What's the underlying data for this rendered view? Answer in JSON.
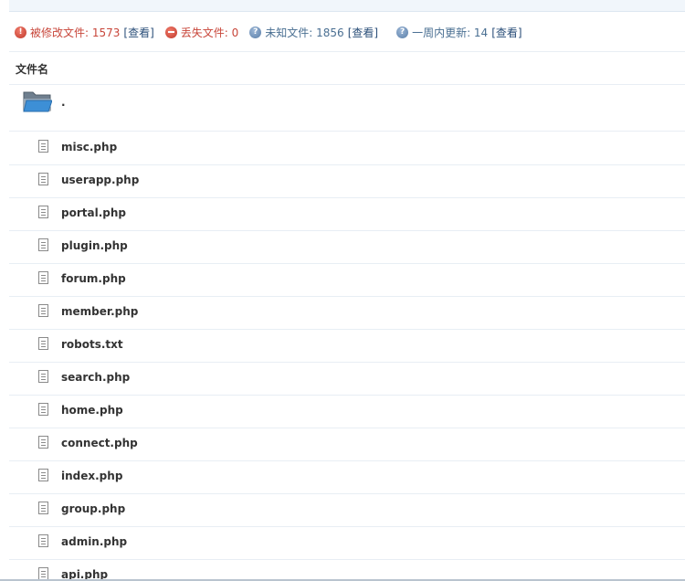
{
  "stats": {
    "modified": {
      "label": "被修改文件: 1573",
      "link": "[查看]",
      "icon": "warning-icon",
      "color": "#c8463a"
    },
    "missing": {
      "label": "丢失文件: 0",
      "icon": "minus-circle-icon",
      "color": "#c8463a"
    },
    "unknown": {
      "label": "未知文件: 1856",
      "link": "[查看]",
      "icon": "help-icon",
      "color": "#4a6f92"
    },
    "weekly": {
      "label": "一周内更新: 14",
      "link": "[查看]",
      "icon": "help-icon",
      "color": "#4a6f92"
    }
  },
  "table": {
    "column_header": "文件名",
    "folder": {
      "name": ".",
      "icon": "folder-open-icon"
    },
    "files": [
      {
        "name": "misc.php",
        "icon": "file-icon"
      },
      {
        "name": "userapp.php",
        "icon": "file-icon"
      },
      {
        "name": "portal.php",
        "icon": "file-icon"
      },
      {
        "name": "plugin.php",
        "icon": "file-icon"
      },
      {
        "name": "forum.php",
        "icon": "file-icon"
      },
      {
        "name": "member.php",
        "icon": "file-icon"
      },
      {
        "name": "robots.txt",
        "icon": "file-icon"
      },
      {
        "name": "search.php",
        "icon": "file-icon"
      },
      {
        "name": "home.php",
        "icon": "file-icon"
      },
      {
        "name": "connect.php",
        "icon": "file-icon"
      },
      {
        "name": "index.php",
        "icon": "file-icon"
      },
      {
        "name": "group.php",
        "icon": "file-icon"
      },
      {
        "name": "admin.php",
        "icon": "file-icon"
      },
      {
        "name": "api.php",
        "icon": "file-icon"
      }
    ]
  }
}
